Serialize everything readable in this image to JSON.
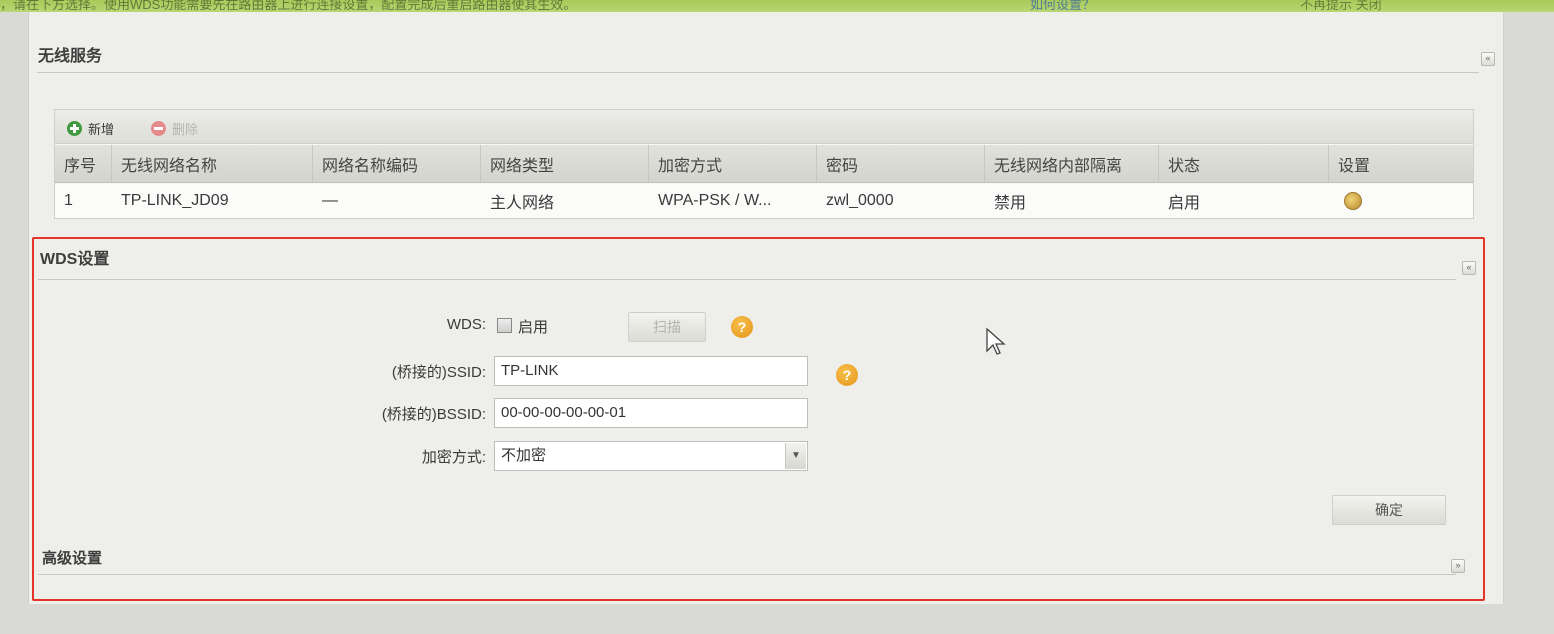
{
  "topbar": {
    "text": "，请在下方选择。使用WDS功能需要先在路由器上进行连接设置，配置完成后重启路由器使其生效。",
    "link": "如何设置？",
    "right": "不再提示   关闭"
  },
  "wireless_service": {
    "title": "无线服务",
    "toolbar": {
      "add_label": "新增",
      "delete_label": "删除"
    },
    "columns": [
      "序号",
      "无线网络名称",
      "网络名称编码",
      "网络类型",
      "加密方式",
      "密码",
      "无线网络内部隔离",
      "状态",
      "设置"
    ],
    "rows": [
      [
        "1",
        "TP-LINK_JD09",
        "—",
        "主人网络",
        "WPA-PSK / W...",
        "zwl_0000",
        "禁用",
        "启用",
        ""
      ]
    ]
  },
  "wds": {
    "title": "WDS设置",
    "wds_label": "WDS:",
    "enable_label": "启用",
    "scan_label": "扫描",
    "ssid_label": "(桥接的)SSID:",
    "ssid_value": "TP-LINK",
    "bssid_label": "(桥接的)BSSID:",
    "bssid_value": "00-00-00-00-00-01",
    "encryption_label": "加密方式:",
    "encryption_value": "不加密",
    "help_glyph": "?",
    "confirm_label": "确定"
  },
  "advanced": {
    "title": "高级设置"
  },
  "icons": {
    "collapse_up": "«",
    "collapse_down": "»",
    "select_arrow": "▼"
  },
  "colors": {
    "highlight_border": "#e53528",
    "help_icon": "#e4941a",
    "topbar": "#b9d672"
  }
}
